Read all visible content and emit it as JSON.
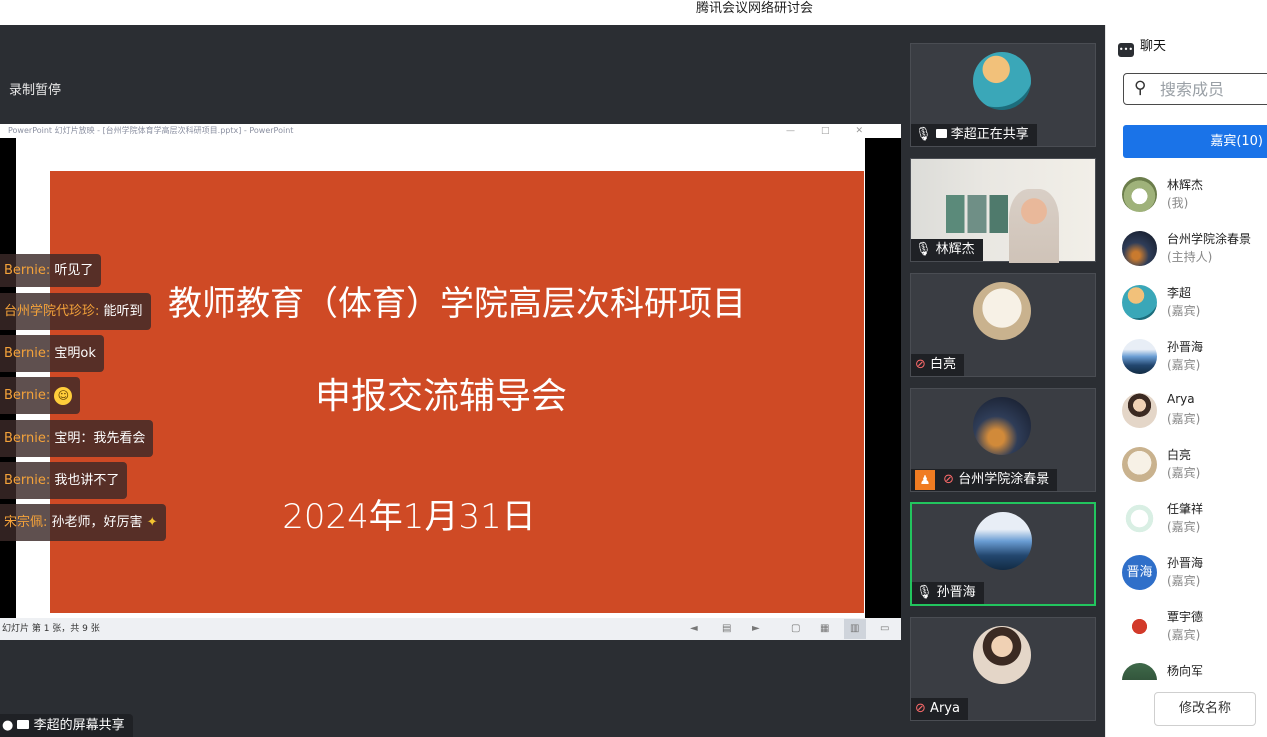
{
  "window": {
    "title": "腾讯会议网络研讨会"
  },
  "stage": {
    "recording": "录制暂停",
    "ppt_title": "PowerPoint 幻灯片放映 - [台州学院体育学高层次科研项目.pptx] - PowerPoint",
    "slide": {
      "line1": "教师教育（体育）学院高层次科研项目",
      "line2": "申报交流辅导会",
      "line3": "2024年1月31日"
    },
    "slide_status": "幻灯片 第 1 张，共 9 张",
    "share_label": "李超的屏幕共享"
  },
  "danmaku": [
    {
      "name": "Bernie:",
      "text": "听见了"
    },
    {
      "name": "台州学院代珍珍:",
      "text": "能听到"
    },
    {
      "name": "Bernie:",
      "text": "宝明ok"
    },
    {
      "name": "Bernie:",
      "text": ""
    },
    {
      "name": "Bernie:",
      "text": "宝明：我先看会"
    },
    {
      "name": "Bernie:",
      "text": "我也讲不了"
    },
    {
      "name": "宋宗佩:",
      "text": "孙老师，好厉害"
    }
  ],
  "video_tiles": [
    {
      "label": "李超正在共享",
      "mic": "on"
    },
    {
      "label": "林辉杰",
      "mic": "on"
    },
    {
      "label": "白亮",
      "mic": "muted"
    },
    {
      "label": "台州学院涂春景",
      "mic": "muted"
    },
    {
      "label": "孙晋海",
      "mic": "on",
      "speaking": true
    },
    {
      "label": "Arya",
      "mic": "muted"
    }
  ],
  "sidebar": {
    "chat_label": "聊天",
    "search_placeholder": "搜索成员",
    "tab_label": "嘉宾(10)",
    "members": [
      {
        "name": "林辉杰",
        "role": "(我)"
      },
      {
        "name": "台州学院涂春景",
        "role": "(主持人)"
      },
      {
        "name": "李超",
        "role": "(嘉宾)"
      },
      {
        "name": "孙晋海",
        "role": "(嘉宾)"
      },
      {
        "name": "Arya",
        "role": "(嘉宾)"
      },
      {
        "name": "白亮",
        "role": "(嘉宾)"
      },
      {
        "name": "任肇祥",
        "role": "(嘉宾)"
      },
      {
        "name": "孙晋海",
        "role": "(嘉宾)",
        "avatar_text": "晋海"
      },
      {
        "name": "覃宇德",
        "role": "(嘉宾)"
      },
      {
        "name": "杨向军",
        "role": ""
      }
    ],
    "rename_label": "修改名称"
  }
}
